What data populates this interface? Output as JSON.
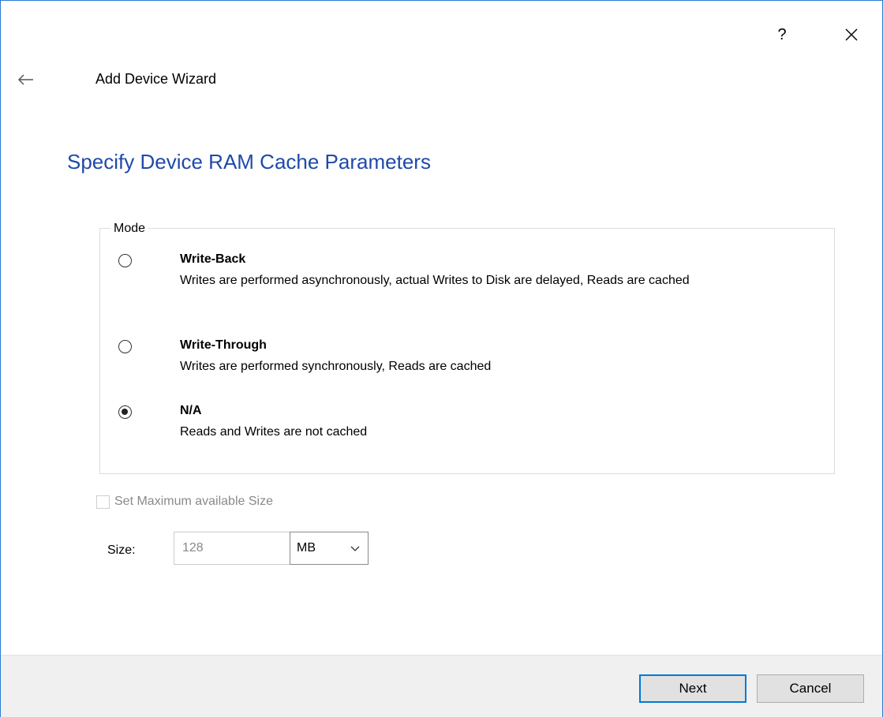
{
  "window": {
    "help_label": "?",
    "wizard_title": "Add Device Wizard",
    "heading": "Specify Device RAM Cache Parameters",
    "accent": "#1f4aa8"
  },
  "mode": {
    "legend": "Mode",
    "options": [
      {
        "title": "Write-Back",
        "description": "Writes are performed asynchronously, actual Writes to Disk are delayed, Reads are cached",
        "selected": false
      },
      {
        "title": "Write-Through",
        "description": "Writes are performed synchronously, Reads are cached",
        "selected": false
      },
      {
        "title": "N/A",
        "description": "Reads and Writes are not cached",
        "selected": true
      }
    ]
  },
  "max_size": {
    "label": "Set Maximum available Size",
    "checked": false,
    "disabled": true
  },
  "size": {
    "label": "Size:",
    "value": "128",
    "unit": "MB"
  },
  "footer": {
    "next_label": "Next",
    "cancel_label": "Cancel"
  }
}
